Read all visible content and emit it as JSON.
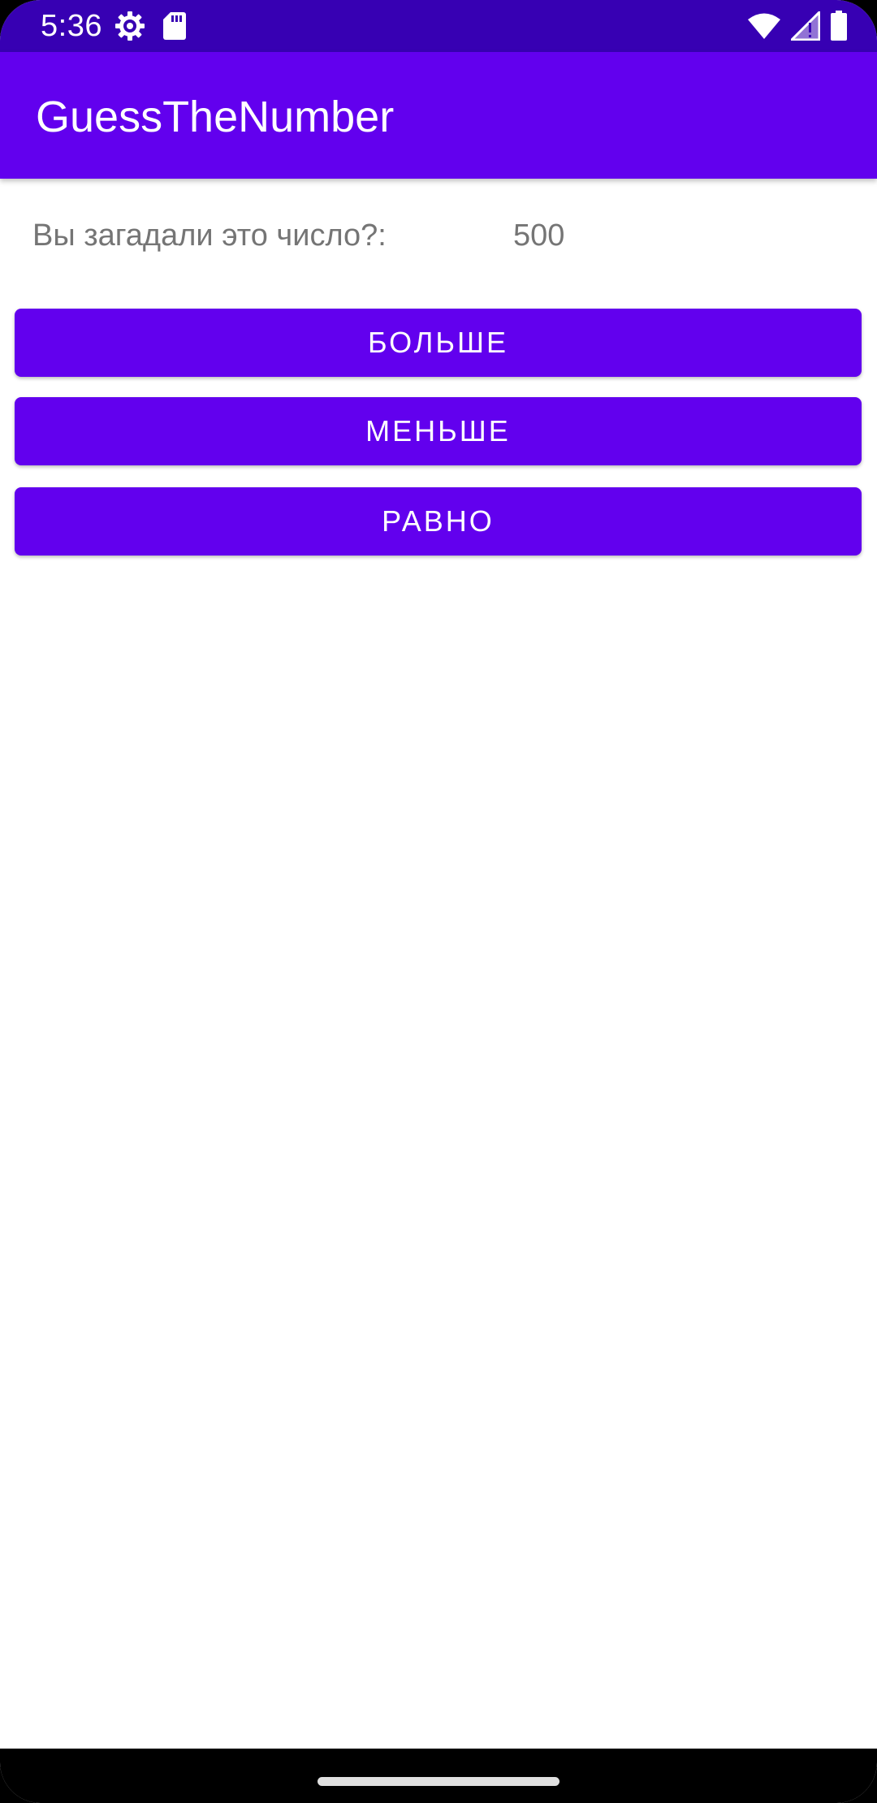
{
  "status_bar": {
    "time": "5:36",
    "left_icons": [
      "settings-icon",
      "sd-card-icon"
    ],
    "right_icons": [
      "wifi-icon",
      "cellular-signal-icon",
      "battery-icon"
    ],
    "background_color": "#3700b3"
  },
  "app_bar": {
    "title": "GuessTheNumber",
    "background_color": "#6200ee"
  },
  "main": {
    "question_label": "Вы загадали это число?:",
    "guess_value": "500",
    "buttons": {
      "more_label": "БОЛЬШЕ",
      "less_label": "МЕНЬШЕ",
      "equal_label": "РАВНО"
    },
    "button_color": "#6200ee"
  },
  "nav_bar": {
    "handle": "home-gesture-handle"
  }
}
